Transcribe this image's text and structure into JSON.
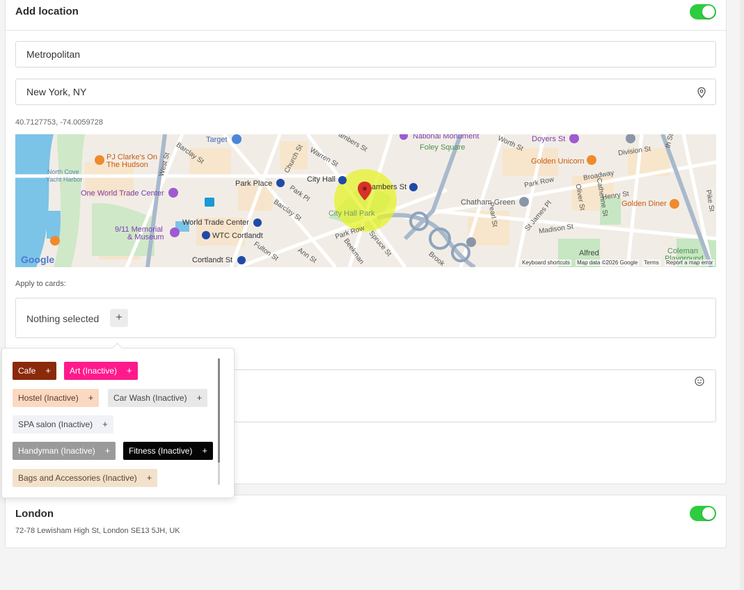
{
  "location_card": {
    "title": "Add location",
    "toggle_on": true,
    "name_value": "Metropolitan",
    "address_value": "New York, NY",
    "coordinates": "40.7127753, -74.0059728"
  },
  "map": {
    "labels": {
      "target": "Target",
      "chambers_st_top": "ambers St",
      "national_monument": "National Monument",
      "foley_square": "Foley Square",
      "worth_st": "Worth St",
      "doyers_st": "Doyers St",
      "division_st": "Division St",
      "pj_clarkes": "PJ Clarke's On",
      "the_hudson": "The Hudson",
      "barclay_st": "Barclay St",
      "west_st": "West St",
      "church_st": "Church St",
      "warren_st": "Warren St",
      "north_cove": "North Cove",
      "yacht_harbor": "Yacht Harbor",
      "golden_unicorn": "Golden Unicorn",
      "broadway": "Broadway",
      "park_place": "Park Place",
      "city_hall": "City Hall",
      "chambers_st": "ambers St",
      "park_row": "Park Row",
      "one_wtc": "One World Trade Center",
      "park_pl": "Park Pl",
      "henry_st": "Henry St",
      "golden_diner": "Golden Diner",
      "chatham_green": "Chatham Green",
      "pike_st": "Pike St",
      "city_hall_park": "City Hall Park",
      "barclay_st2": "Barclay St",
      "wtc": "World Trade Center",
      "memorial": "9/11 Memorial",
      "museum": "& Museum",
      "wtc_cortlandt": "WTC Cortlandt",
      "park_row2": "Park Row",
      "madison_st": "Madison St",
      "cortlandt_st": "Cortlandt St",
      "fulton_st": "Fulton St",
      "ann_st": "Ann St",
      "beekman": "Beekman",
      "spruce_st": "Spruce St",
      "brook": "Brook",
      "alfred": "Alfred",
      "coleman": "Coleman",
      "playground": "Playground",
      "oliver_st": "Oliver St",
      "catherine_st": "Catherine St",
      "pearl_st": "Pearl St",
      "st_james_pl": "St James Pl",
      "th_st": "th St"
    },
    "google": "Google",
    "keyboard_shortcuts": "Keyboard shortcuts",
    "map_data": "Map data ©2026 Google",
    "terms": "Terms",
    "report_error": "Report a map error"
  },
  "apply_to_cards": {
    "label": "Apply to cards:",
    "placeholder": "Nothing selected",
    "add_symbol": "+"
  },
  "popover": {
    "chips": [
      {
        "label": "Cafe",
        "bg": "#8a2a0a",
        "fg": "#ffffff"
      },
      {
        "label": "Art (Inactive)",
        "bg": "#ff1a8c",
        "fg": "#ffffff"
      },
      {
        "label": "Hostel (Inactive)",
        "bg": "#fbd8c1",
        "fg": "#5a3a2a"
      },
      {
        "label": "Car Wash (Inactive)",
        "bg": "#e8e8e8",
        "fg": "#444444"
      },
      {
        "label": "SPA salon (Inactive)",
        "bg": "#f1f2f7",
        "fg": "#444444"
      },
      {
        "label": "Handyman (Inactive)",
        "bg": "#9a9a9a",
        "fg": "#ffffff"
      },
      {
        "label": "Fitness (Inactive)",
        "bg": "#050505",
        "fg": "#ffffff"
      },
      {
        "label": "Bags and Accessories (Inactive)",
        "bg": "#f3e2cb",
        "fg": "#5a4330"
      }
    ],
    "plus": "+"
  },
  "london_card": {
    "title": "London",
    "address": "72-78 Lewisham High St, London SE13 5JH, UK",
    "toggle_on": true
  },
  "colors": {
    "toggle": "#2ecc40",
    "map_water": "#7cc3e8",
    "map_park": "#c7e6c2",
    "highlight": "#e6f22a"
  }
}
